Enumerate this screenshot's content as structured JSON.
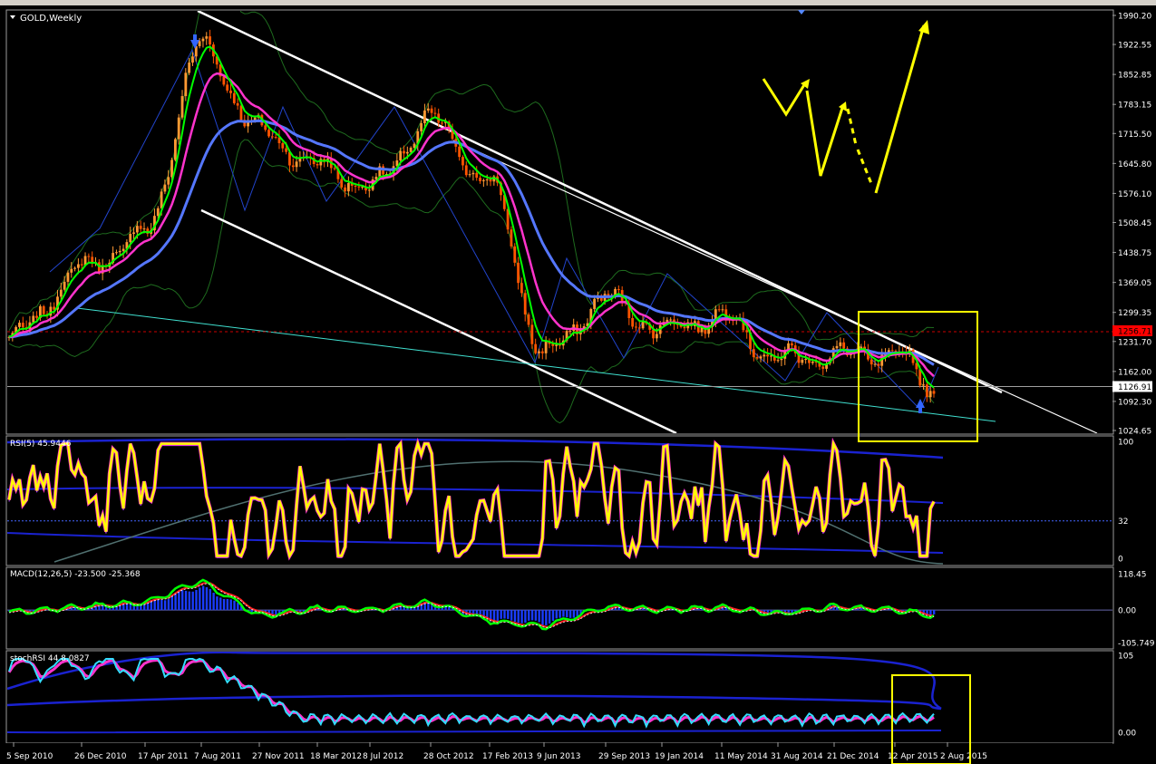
{
  "window": {
    "title": "GOLD,Weekly"
  },
  "colors": {
    "background": "#000000",
    "grid": "#9a9a9a",
    "bull": "#ff9933",
    "bear": "#ff5500",
    "ema_fast": "#00ff00",
    "ema_mid": "#ff33cc",
    "ema_slow": "#5577ff",
    "channel": "#ffffff",
    "support": "#40e0d0",
    "annotation": "#ffff00",
    "price_label_bg": "#ff0000",
    "rsi_line": "#ffff00",
    "macd_hist": "#1a3cff",
    "stoch_k": "#33ddff",
    "stoch_d": "#ff33cc"
  },
  "panels": {
    "price": {
      "label": "GOLD,Weekly",
      "ticks": [
        "1990.20",
        "1922.55",
        "1852.85",
        "1783.15",
        "1715.50",
        "1645.80",
        "1576.10",
        "1508.45",
        "1438.75",
        "1369.05",
        "1299.35",
        "1231.70",
        "1162.00",
        "1092.30",
        "1024.65"
      ],
      "current_price_label": "1126.91",
      "level_label": "1256.71",
      "current_price": 1126.91,
      "level": 1256.71
    },
    "rsi": {
      "label": "RSI(5) 45.9446",
      "ticks": [
        "100",
        "32",
        "0"
      ]
    },
    "macd": {
      "label": "MACD(12,26,5) -23.500 -25.368",
      "ticks": [
        "118.45",
        "0.00",
        "-105.749"
      ]
    },
    "stoch": {
      "label": "stochRSI 44 8.0827",
      "ticks": [
        "105",
        "0.00"
      ]
    }
  },
  "x_axis": {
    "dates": [
      "5 Sep 2010",
      "26 Dec 2010",
      "17 Apr 2011",
      "7 Aug 2011",
      "27 Nov 2011",
      "18 Mar 2012",
      "8 Jul 2012",
      "28 Oct 2012",
      "17 Feb 2013",
      "9 Jun 2013",
      "29 Sep 2013",
      "19 Jan 2014",
      "11 May 2014",
      "31 Aug 2014",
      "21 Dec 2014",
      "12 Apr 2015",
      "2 Aug 2015"
    ]
  },
  "chart_data": [
    {
      "type": "candlestick",
      "title": "GOLD,Weekly",
      "ylim": [
        1024.65,
        1990.2
      ],
      "key_points": [
        {
          "x": "5 Sep 2010",
          "y": 1240
        },
        {
          "x": "26 Dec 2010",
          "y": 1400
        },
        {
          "x": "17 Apr 2011",
          "y": 1480
        },
        {
          "x": "7 Aug 2011",
          "y": 1920
        },
        {
          "x": "27 Nov 2011",
          "y": 1720
        },
        {
          "x": "18 Mar 2012",
          "y": 1640
        },
        {
          "x": "8 Jul 2012",
          "y": 1590
        },
        {
          "x": "28 Oct 2012",
          "y": 1745
        },
        {
          "x": "17 Feb 2013",
          "y": 1600
        },
        {
          "x": "9 Jun 2013",
          "y": 1200
        },
        {
          "x": "29 Sep 2013",
          "y": 1330
        },
        {
          "x": "19 Jan 2014",
          "y": 1260
        },
        {
          "x": "11 May 2014",
          "y": 1290
        },
        {
          "x": "31 Aug 2014",
          "y": 1190
        },
        {
          "x": "21 Dec 2014",
          "y": 1200
        },
        {
          "x": "12 Apr 2015",
          "y": 1200
        },
        {
          "x": "2 Aug 2015",
          "y": 1090
        },
        {
          "x": "last",
          "y": 1127
        }
      ]
    },
    {
      "type": "line",
      "title": "MACD(12,26,5)",
      "ylim": [
        -105.749,
        118.45
      ],
      "values_at_dates": [
        -5,
        10,
        25,
        95,
        -20,
        5,
        0,
        25,
        -35,
        -55,
        10,
        0,
        8,
        -12,
        10,
        0,
        -23.5
      ]
    },
    {
      "type": "line",
      "title": "RSI(5)",
      "ylim": [
        0,
        100
      ],
      "reference_level": 32
    },
    {
      "type": "line",
      "title": "stochRSI",
      "ylim": [
        0,
        105
      ]
    }
  ]
}
